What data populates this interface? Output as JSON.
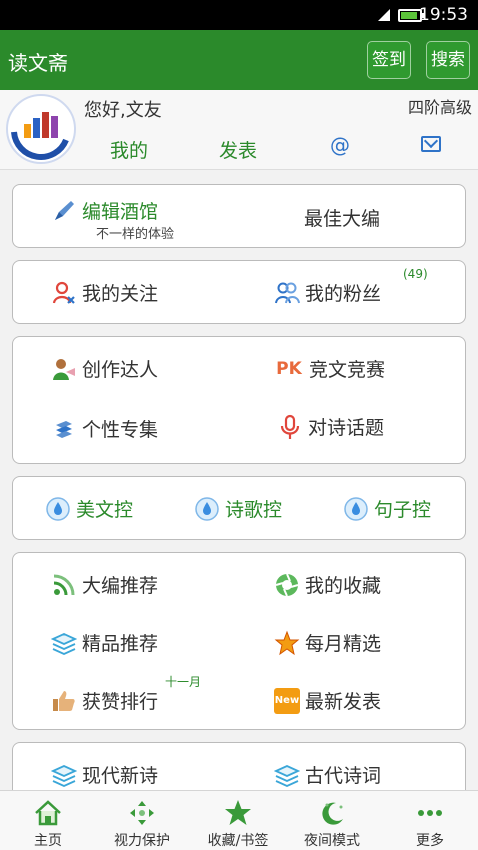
{
  "status": {
    "time": "19:53"
  },
  "app": {
    "title": "读文斋",
    "checkin": "签到",
    "search": "搜索"
  },
  "profile": {
    "greeting": "您好,文友",
    "level": "四阶高级",
    "tabs": [
      "我的",
      "发表",
      "@"
    ]
  },
  "editor": {
    "title": "编辑酒馆",
    "subtitle": "不一样的体验",
    "best": "最佳大编"
  },
  "social": {
    "follow": "我的关注",
    "fans": "我的粉丝",
    "fans_count": "(49)"
  },
  "creation": {
    "expert": "创作达人",
    "contest": "竞文竞赛",
    "special": "个性专集",
    "topic": "对诗话题",
    "pk": "PK"
  },
  "categories": [
    "美文控",
    "诗歌控",
    "句子控"
  ],
  "recommend": {
    "editor_pick": "大编推荐",
    "favorites": "我的收藏",
    "quality": "精品推荐",
    "monthly": "每月精选",
    "ranking": "获赞排行",
    "ranking_tag": "十一月",
    "latest": "最新发表",
    "new_tag": "New"
  },
  "poems": {
    "modern": "现代新诗",
    "ancient": "古代诗词"
  },
  "bottom_nav": [
    "主页",
    "视力保护",
    "收藏/书签",
    "夜间模式",
    "更多"
  ],
  "colors": {
    "appbar": "#2b8a2b",
    "accent_green": "#2b8a2b",
    "accent_blue": "#2f73c8"
  }
}
